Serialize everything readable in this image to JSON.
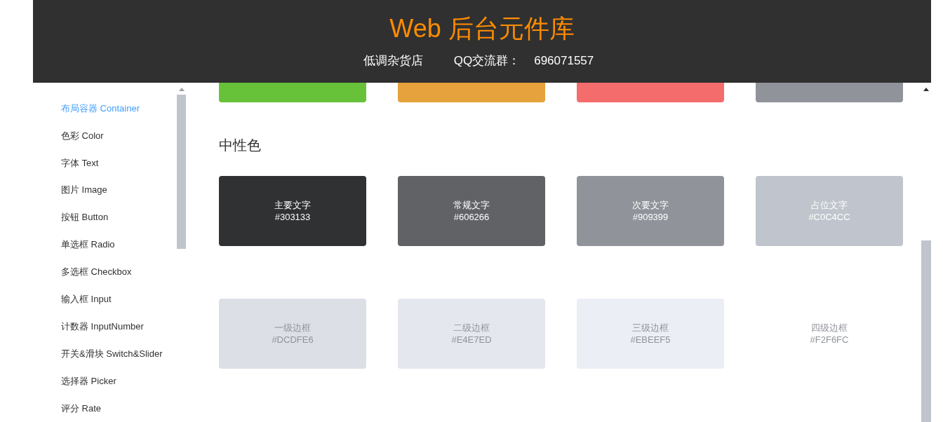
{
  "header": {
    "title": "Web 后台元件库",
    "shop": "低调杂货店",
    "qq_label": "QQ交流群：",
    "qq_number": "696071557"
  },
  "sidebar": {
    "items": [
      {
        "label": "布局容器 Container",
        "selected": true
      },
      {
        "label": "色彩 Color",
        "selected": false
      },
      {
        "label": "字体 Text",
        "selected": false
      },
      {
        "label": "图片 Image",
        "selected": false
      },
      {
        "label": "按钮 Button",
        "selected": false
      },
      {
        "label": "单选框 Radio",
        "selected": false
      },
      {
        "label": "多选框 Checkbox",
        "selected": false
      },
      {
        "label": "输入框 Input",
        "selected": false
      },
      {
        "label": "计数器 InputNumber",
        "selected": false
      },
      {
        "label": "开关&滑块 Switch&Slider",
        "selected": false
      },
      {
        "label": "选择器 Picker",
        "selected": false
      },
      {
        "label": "评分 Rate",
        "selected": false
      }
    ]
  },
  "top_swatches": [
    {
      "color": "#67c23a"
    },
    {
      "color": "#e6a23c"
    },
    {
      "color": "#f56c6c"
    },
    {
      "color": "#909399"
    }
  ],
  "neutral": {
    "title": "中性色",
    "rows": [
      [
        {
          "kind": "text",
          "name": "主要文字",
          "hex": "#303133",
          "color": "#303133"
        },
        {
          "kind": "text",
          "name": "常规文字",
          "hex": "#606266",
          "color": "#606266"
        },
        {
          "kind": "text",
          "name": "次要文字",
          "hex": "#909399",
          "color": "#909399"
        },
        {
          "kind": "text",
          "name": "占位文字",
          "hex": "#C0C4CC",
          "color": "#c0c4cc"
        }
      ],
      [
        {
          "kind": "border",
          "name": "一级边框",
          "hex": "#DCDFE6",
          "color": "#dcdfe6"
        },
        {
          "kind": "border",
          "name": "二级边框",
          "hex": "#E4E7ED",
          "color": "#e4e7ed"
        },
        {
          "kind": "border",
          "name": "三级边框",
          "hex": "#EBEEF5",
          "color": "#ebeef5"
        },
        {
          "kind": "border",
          "name": "四级边框",
          "hex": "#F2F6FC",
          "color": "#ffffff"
        }
      ]
    ]
  }
}
